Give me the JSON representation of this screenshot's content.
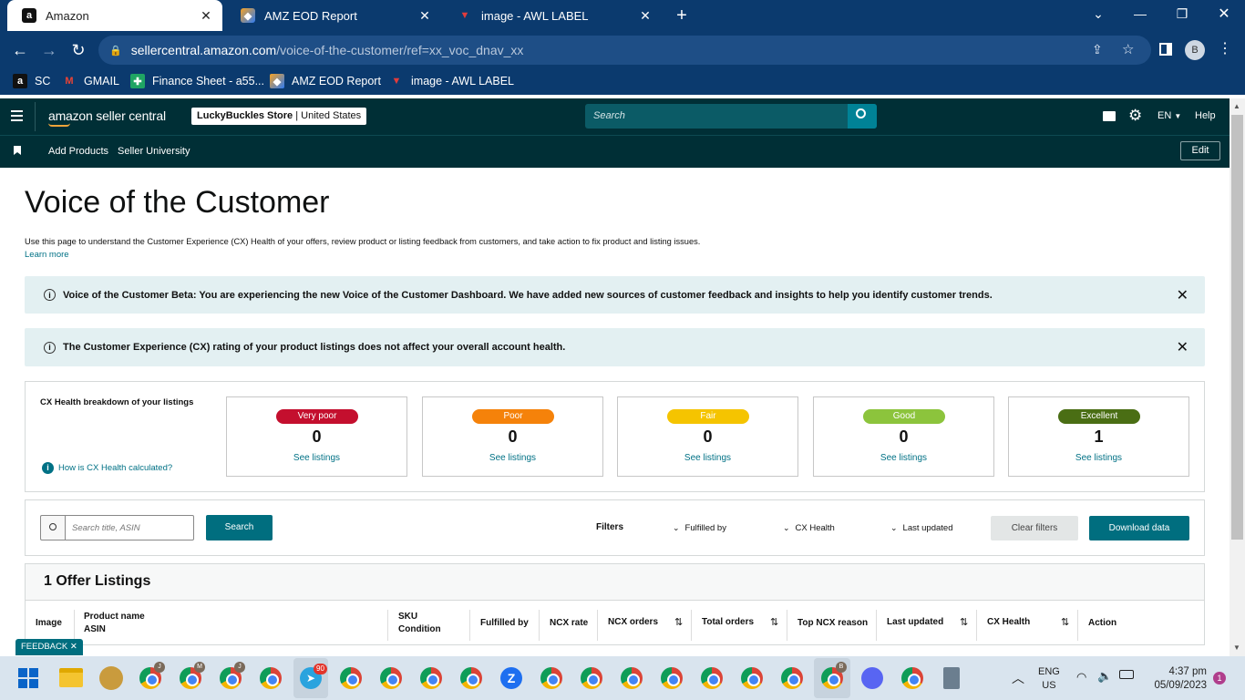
{
  "browser": {
    "tabs": [
      {
        "label": "Amazon",
        "icon": "amazon-icon"
      },
      {
        "label": "AMZ EOD Report",
        "icon": "sheets-icon"
      },
      {
        "label": "image - AWL LABEL",
        "icon": "awl-icon"
      }
    ],
    "url_host": "sellercentral.amazon.com",
    "url_path": "/voice-of-the-customer/ref=xx_voc_dnav_xx",
    "profile_initial": "B",
    "bookmarks": [
      {
        "label": "SC",
        "icon": "amazon-icon"
      },
      {
        "label": "GMAIL",
        "icon": "gmail-icon"
      },
      {
        "label": "Finance Sheet - a55...",
        "icon": "finance-icon"
      },
      {
        "label": "AMZ EOD Report",
        "icon": "sheets-icon"
      },
      {
        "label": "image - AWL LABEL",
        "icon": "awl-icon"
      }
    ]
  },
  "sc_header": {
    "logo": "amazon seller central",
    "store": "LuckyBuckles Store",
    "market": "United States",
    "search_placeholder": "Search",
    "language": "EN",
    "help": "Help",
    "subnav": [
      "Add Products",
      "Seller University"
    ],
    "edit": "Edit"
  },
  "page": {
    "title": "Voice of the Customer",
    "description": "Use this page to understand the Customer Experience (CX) Health of your offers, review product or listing feedback from customers, and take action to fix product and listing issues.",
    "learn_more": "Learn more",
    "alerts": [
      "Voice of the Customer Beta: You are experiencing the new Voice of the Customer Dashboard. We have added new sources of customer feedback and insights to help you identify customer trends.",
      "The Customer Experience (CX) rating of your product listings does not affect your overall account health."
    ],
    "breakdown_title": "CX Health breakdown of your listings",
    "how_calculated": "How is CX Health calculated?",
    "health_cards": [
      {
        "label": "Very poor",
        "count": "0",
        "link": "See listings",
        "color": "#c40f2e",
        "text_color": "#ffffff"
      },
      {
        "label": "Poor",
        "count": "0",
        "link": "See listings",
        "color": "#f5820a",
        "text_color": "#ffffff"
      },
      {
        "label": "Fair",
        "count": "0",
        "link": "See listings",
        "color": "#f5c400",
        "text_color": "#ffffff"
      },
      {
        "label": "Good",
        "count": "0",
        "link": "See listings",
        "color": "#8cc43c",
        "text_color": "#ffffff"
      },
      {
        "label": "Excellent",
        "count": "1",
        "link": "See listings",
        "color": "#4a6e14",
        "text_color": "#ffffff"
      }
    ],
    "filter_bar": {
      "search_placeholder": "Search title, ASIN",
      "search_button": "Search",
      "filters_label": "Filters",
      "dropdowns": [
        "Fulfilled by",
        "CX Health",
        "Last updated"
      ],
      "clear": "Clear filters",
      "download": "Download data"
    },
    "listings_title": "1 Offer Listings",
    "columns": {
      "image": "Image",
      "product_name": "Product name",
      "asin": "ASIN",
      "sku": "SKU",
      "condition": "Condition",
      "fulfilled_by": "Fulfilled by",
      "ncx_rate": "NCX rate",
      "ncx_orders": "NCX orders",
      "total_orders": "Total orders",
      "top_ncx_reason": "Top NCX reason",
      "last_updated": "Last updated",
      "cx_health": "CX Health",
      "action": "Action"
    },
    "feedback_tab": "FEEDBACK ✕"
  },
  "taskbar": {
    "language_line1": "ENG",
    "language_line2": "US",
    "time": "4:37 pm",
    "date": "05/09/2023",
    "notification_count": "1",
    "telegram_badge": "90"
  }
}
